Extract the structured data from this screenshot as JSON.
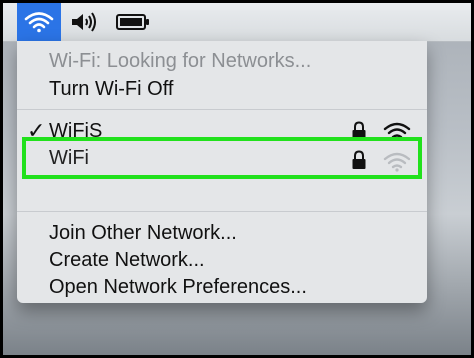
{
  "menubar": {
    "wifi_icon": "wifi-icon",
    "volume_icon": "speaker-volume-icon",
    "battery_icon": "battery-icon"
  },
  "menu": {
    "status": "Wi-Fi: Looking for Networks...",
    "toggle": "Turn Wi-Fi Off",
    "networks": [
      {
        "name": "WiFiS",
        "selected": true,
        "locked": true
      },
      {
        "name": "WiFi",
        "selected": false,
        "locked": true
      }
    ],
    "actions": {
      "join_other": "Join Other Network...",
      "create": "Create Network...",
      "preferences": "Open Network Preferences..."
    }
  },
  "colors": {
    "accent": "#2b74e6",
    "highlight": "#21e11c"
  }
}
